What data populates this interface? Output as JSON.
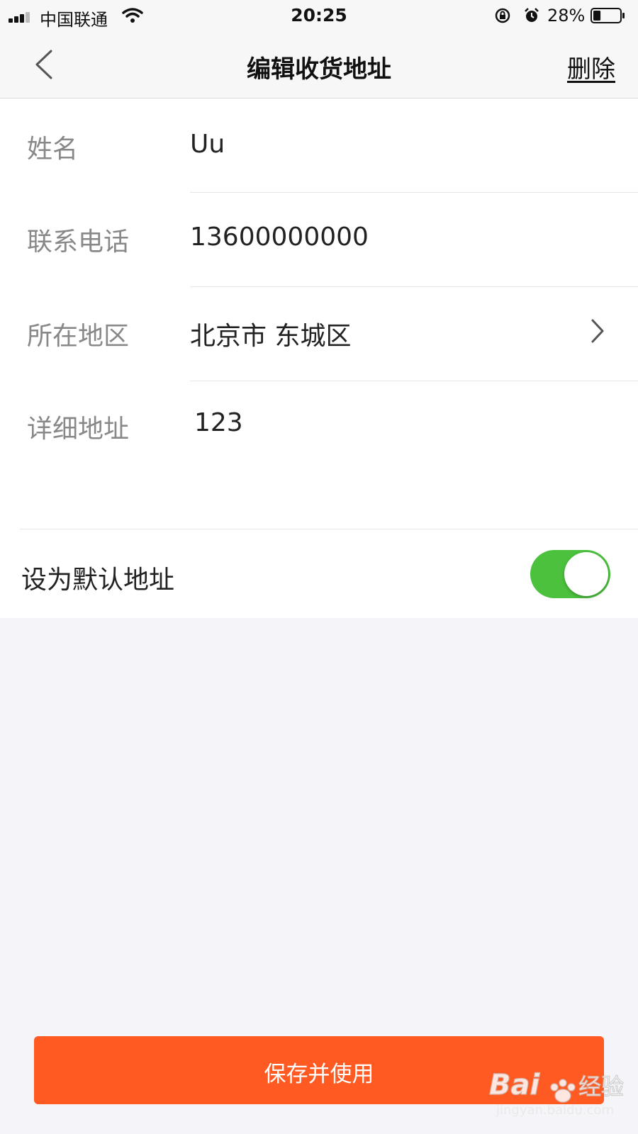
{
  "status_bar": {
    "carrier": "中国联通",
    "time": "20:25",
    "battery_percent": "28%",
    "battery_level": 0.28
  },
  "nav": {
    "title": "编辑收货地址",
    "delete_label": "删除",
    "back_icon": "chevron-left-icon"
  },
  "form": {
    "fields": [
      {
        "label": "姓名",
        "value": "Uu"
      },
      {
        "label": "联系电话",
        "value": "13600000000"
      },
      {
        "label": "所在地区",
        "value": "北京市 东城区"
      },
      {
        "label": "详细地址",
        "value": "123"
      }
    ],
    "default_address": {
      "label": "设为默认地址",
      "enabled": true,
      "toggle_color": "#4cc13e"
    }
  },
  "save_button": {
    "label": "保存并使用",
    "color": "#ff5a22"
  },
  "watermark": {
    "brand": "Bai",
    "brand_suffix": "经验",
    "url": "jingyan.baidu.com"
  }
}
